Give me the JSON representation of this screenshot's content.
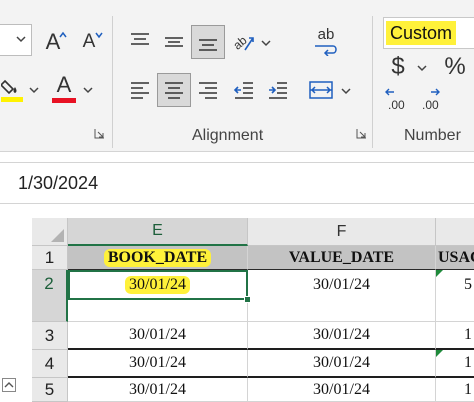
{
  "ribbon": {
    "font_group": {
      "grow_font_label": "A",
      "shrink_font_label": "A",
      "font_color_label": "A",
      "font_color": "#e81123",
      "fill_color": "#fff200"
    },
    "alignment_group": {
      "label": "Alignment",
      "wrap_text_label": "ab"
    },
    "number_group": {
      "label": "Number",
      "format_value": "Custom",
      "currency_symbol": "$",
      "percent_symbol": "%",
      "increase_decimal_label": ".00",
      "decrease_decimal_label": ".00"
    }
  },
  "formula_bar": {
    "content": "1/30/2024"
  },
  "grid": {
    "columns": [
      "E",
      "F"
    ],
    "selected_column": "E",
    "rows": [
      {
        "row_number": "1",
        "cells": [
          "BOOK_DATE",
          "VALUE_DATE",
          "USAC"
        ]
      },
      {
        "row_number": "2",
        "cells": [
          "30/01/24",
          "30/01/24",
          "5"
        ]
      },
      {
        "row_number": "3",
        "cells": [
          "30/01/24",
          "30/01/24",
          "1"
        ]
      },
      {
        "row_number": "4",
        "cells": [
          "30/01/24",
          "30/01/24",
          "1"
        ]
      },
      {
        "row_number": "5",
        "cells": [
          "30/01/24",
          "30/01/24",
          "1"
        ]
      }
    ],
    "selected_row": "2",
    "active_cell": "E2",
    "highlight_color": "#fff13a",
    "selection_color": "#217346"
  }
}
